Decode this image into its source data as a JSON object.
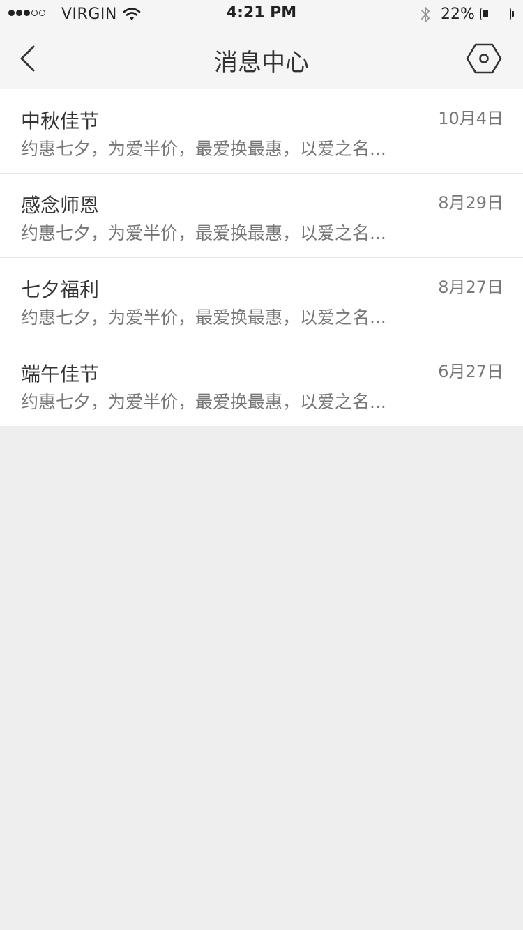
{
  "status_bar": {
    "carrier": "VIRGIN",
    "time": "4:21 PM",
    "battery_percent": "22%",
    "battery_level": 0.22,
    "signal_bars_filled": 3,
    "signal_bars_total": 5
  },
  "nav": {
    "title": "消息中心",
    "back_icon": "chevron-left-icon",
    "settings_icon": "hexagon-gear-icon"
  },
  "messages": [
    {
      "title": "中秋佳节",
      "date": "10月4日",
      "preview": "约惠七夕，为爱半价，最爱换最惠，以爱之名..."
    },
    {
      "title": "感念师恩",
      "date": "8月29日",
      "preview": "约惠七夕，为爱半价，最爱换最惠，以爱之名..."
    },
    {
      "title": "七夕福利",
      "date": "8月27日",
      "preview": "约惠七夕，为爱半价，最爱换最惠，以爱之名..."
    },
    {
      "title": "端午佳节",
      "date": "6月27日",
      "preview": "约惠七夕，为爱半价，最爱换最惠，以爱之名..."
    }
  ],
  "colors": {
    "background": "#eeeeee",
    "bar_background": "#f5f5f5",
    "list_background": "#ffffff",
    "primary_text": "#333333",
    "secondary_text": "#777777"
  }
}
